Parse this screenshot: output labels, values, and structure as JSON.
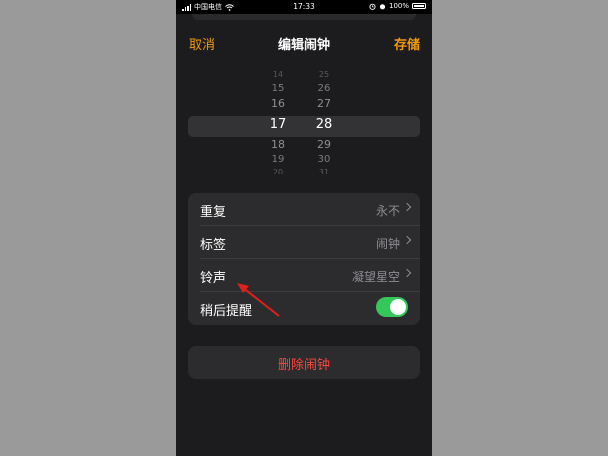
{
  "status_bar": {
    "carrier": "中国电信",
    "time": "17:33",
    "battery": "100%"
  },
  "nav": {
    "cancel_label": "取消",
    "title": "编辑闹钟",
    "save_label": "存储"
  },
  "picker": {
    "hours": [
      "14",
      "15",
      "16",
      "17",
      "18",
      "19",
      "20"
    ],
    "minutes": [
      "25",
      "26",
      "27",
      "28",
      "29",
      "30",
      "31"
    ],
    "selected_hour": "17",
    "selected_minute": "28"
  },
  "settings": [
    {
      "label": "重复",
      "value": "永不"
    },
    {
      "label": "标签",
      "value": "闹钟"
    },
    {
      "label": "铃声",
      "value": "凝望星空"
    },
    {
      "label": "稍后提醒",
      "toggle_on": true
    }
  ],
  "delete_label": "删除闹钟",
  "colors": {
    "accent": "#f19a0f",
    "destructive": "#ff453a",
    "toggle_on": "#34c759",
    "annotation": "#e0201c"
  },
  "icons": [
    "signal-icon",
    "wifi-icon",
    "alarm-icon",
    "battery-icon",
    "chevron-right-icon"
  ]
}
